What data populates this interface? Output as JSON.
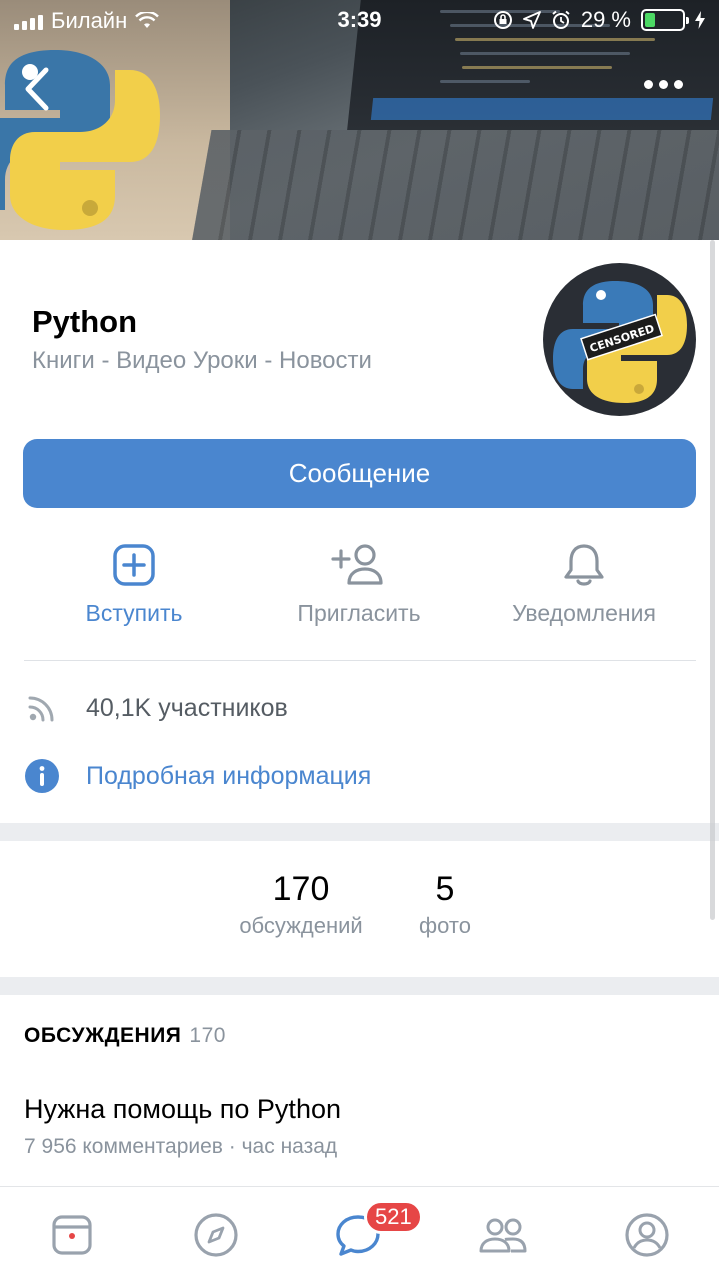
{
  "status_bar": {
    "carrier": "Билайн",
    "time": "3:39",
    "battery": "29 %",
    "battery_level": 0.29,
    "icons": [
      "signal-icon",
      "wifi-icon",
      "orientation-lock-icon",
      "location-icon",
      "alarm-icon",
      "battery-icon",
      "charging-icon"
    ]
  },
  "header": {
    "back_icon": "chevron-left-icon",
    "more_icon": "more-dots-icon"
  },
  "group": {
    "name": "Python",
    "status": "Книги - Видео Уроки - Новости",
    "avatar_label": "CENSORED"
  },
  "message_button": "Сообщение",
  "actions": [
    {
      "label": "Вступить",
      "icon": "plus-square-icon"
    },
    {
      "label": "Пригласить",
      "icon": "add-user-icon"
    },
    {
      "label": "Уведомления",
      "icon": "bell-icon"
    }
  ],
  "info": {
    "members": "40,1K участников",
    "details": "Подробная информация"
  },
  "counters": [
    {
      "value": "170",
      "label": "обсуждений"
    },
    {
      "value": "5",
      "label": "фото"
    }
  ],
  "discussions": {
    "title": "ОБСУЖДЕНИЯ",
    "count": "170",
    "items": [
      {
        "title": "Нужна помощь по Python",
        "meta": "7 956 комментариев · час назад"
      }
    ]
  },
  "tabbar": {
    "tabs": [
      "news-icon",
      "discover-icon",
      "messages-icon",
      "friends-icon",
      "profile-icon"
    ],
    "messages_badge": "521"
  },
  "colors": {
    "accent": "#4a86cf",
    "badge": "#e64646",
    "secondary_text": "#8a939d",
    "battery": "#4cd964"
  }
}
